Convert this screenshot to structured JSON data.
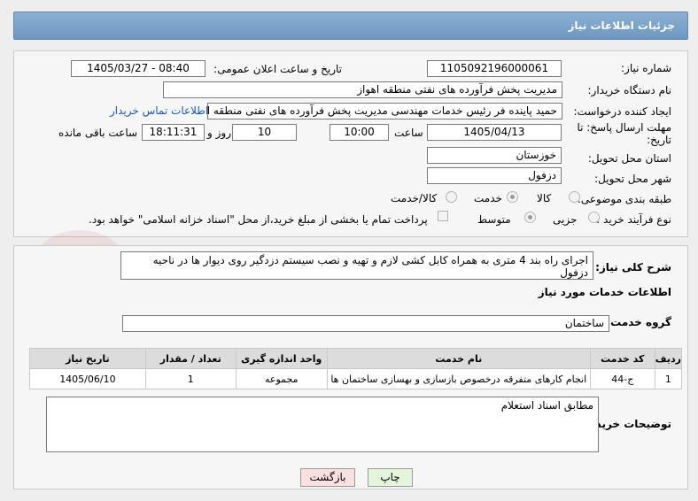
{
  "header": {
    "title": "جزئیات اطلاعات نیاز"
  },
  "form": {
    "need_number_label": "شماره نیاز:",
    "need_number": "1105092196000061",
    "announce_label": "تاریخ و ساعت اعلان عمومی:",
    "announce_value": "1405/03/27 - 08:40",
    "buyer_org_label": "نام دستگاه خریدار:",
    "buyer_org": "مدیریت پخش فرآورده های نفتی منطقه اهواز",
    "creator_label": "ایجاد کننده درخواست:",
    "creator": "حمید پاینده فر رئیس خدمات مهندسی مدیریت پخش فرآورده های نفتی منطقه اهواز",
    "contact_link": "اطلاعات تماس خریدار",
    "deadline_label_1": "مهلت ارسال پاسخ: تا",
    "deadline_label_2": "تاریخ:",
    "deadline_date": "1405/04/13",
    "time_label": "ساعت",
    "deadline_time": "10:00",
    "days_value": "10",
    "days_label": "روز و",
    "remaining_time": "18:11:31",
    "remaining_label": "ساعت باقی مانده",
    "province_label": "استان محل تحویل:",
    "province": "خوزستان",
    "city_label": "شهر محل تحویل:",
    "city": "دزفول",
    "category_label": "طبقه بندی موضوعی:",
    "category_options": [
      "کالا",
      "خدمت",
      "کالا/خدمت"
    ],
    "category_selected": "خدمت",
    "process_label": "نوع فرآیند خرید :",
    "process_options": [
      "جزیی",
      "متوسط"
    ],
    "process_selected": "متوسط",
    "payment_note": "پرداخت تمام یا بخشی از مبلغ خرید،از محل \"اسناد خزانه اسلامی\" خواهد بود."
  },
  "description": {
    "label": "شرح کلی نیاز:",
    "text": "اجرای راه بند 4 متری به همراه کابل کشی لازم و تهیه و نصب سیستم دزدگیر روی دیوار ها در ناحیه دزفول"
  },
  "services": {
    "section_title": "اطلاعات خدمات مورد نیاز",
    "group_label": "گروه خدمت:",
    "group_value": "ساختمان",
    "columns": [
      "ردیف",
      "کد خدمت",
      "نام خدمت",
      "واحد اندازه گیری",
      "تعداد / مقدار",
      "تاریخ نیاز"
    ],
    "rows": [
      [
        "1",
        "ج-44",
        "انجام کارهای متفرقه درخصوص بازسازی و بهسازی ساختمان ها",
        "مجموعه",
        "1",
        "1405/06/10"
      ]
    ]
  },
  "buyer_notes": {
    "label": "توضیحات خریدار:",
    "text": "مطابق اسناد استعلام"
  },
  "buttons": {
    "print": "چاپ",
    "back": "بازگشت"
  },
  "watermark": {
    "text": "AriaTender.net"
  },
  "colors": {
    "header": "#7ea3c9",
    "link": "#1a57b8",
    "print_bg": "#e4f5dc",
    "back_bg": "#fbe0e0"
  }
}
